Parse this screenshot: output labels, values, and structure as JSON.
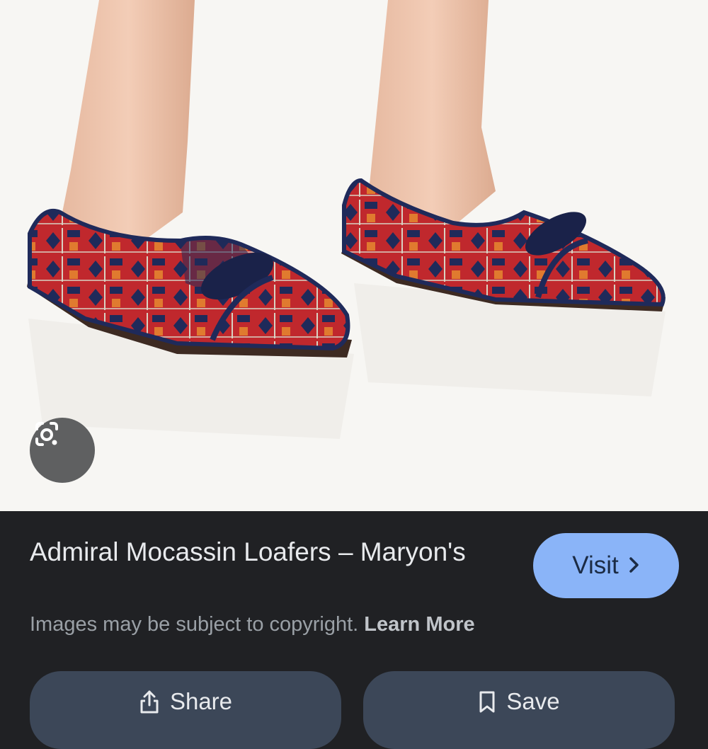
{
  "result": {
    "title": "Admiral Mocassin Loafers – Maryon's",
    "visit_label": "Visit",
    "copyright_text": "Images may be subject to copyright. ",
    "learn_more_label": "Learn More"
  },
  "actions": {
    "share_label": "Share",
    "save_label": "Save"
  },
  "icons": {
    "lens": "google-lens-icon",
    "visit": "chevron-right-icon",
    "share": "share-icon",
    "save": "bookmark-icon"
  },
  "colors": {
    "panel_background": "#202124",
    "visit_button": "#8ab4f8",
    "action_button": "#3c4758",
    "image_background": "#f7f6f3"
  }
}
